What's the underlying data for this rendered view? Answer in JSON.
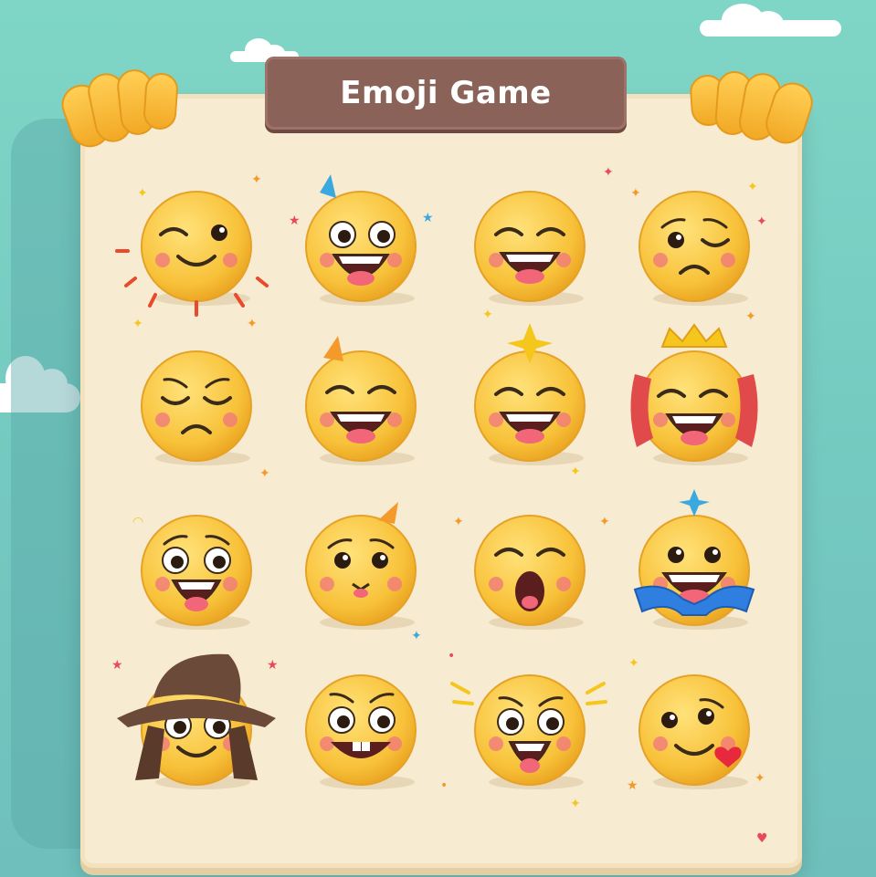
{
  "game": {
    "title": "Emoji Game"
  },
  "colors": {
    "sky": "#7fd6c6",
    "board": "#f7ecd2",
    "banner": "#8b6258",
    "emoji": "#f8c23a",
    "blush": "#f07a7a"
  },
  "emoji_grid": {
    "rows": 4,
    "columns": 4,
    "cells": [
      {
        "name": "winking-face-icon"
      },
      {
        "name": "party-face-icon"
      },
      {
        "name": "grinning-squint-face-icon"
      },
      {
        "name": "worried-wink-face-icon"
      },
      {
        "name": "sad-closed-eyes-face-icon"
      },
      {
        "name": "laughing-party-face-icon"
      },
      {
        "name": "laughing-star-face-icon"
      },
      {
        "name": "crowned-laughing-face-icon"
      },
      {
        "name": "surprised-smile-face-icon"
      },
      {
        "name": "cat-face-icon"
      },
      {
        "name": "yawning-face-icon"
      },
      {
        "name": "bowtie-grin-face-icon"
      },
      {
        "name": "cowboy-hat-face-icon"
      },
      {
        "name": "goofy-face-icon"
      },
      {
        "name": "excited-face-icon"
      },
      {
        "name": "kissing-heart-face-icon"
      }
    ]
  }
}
